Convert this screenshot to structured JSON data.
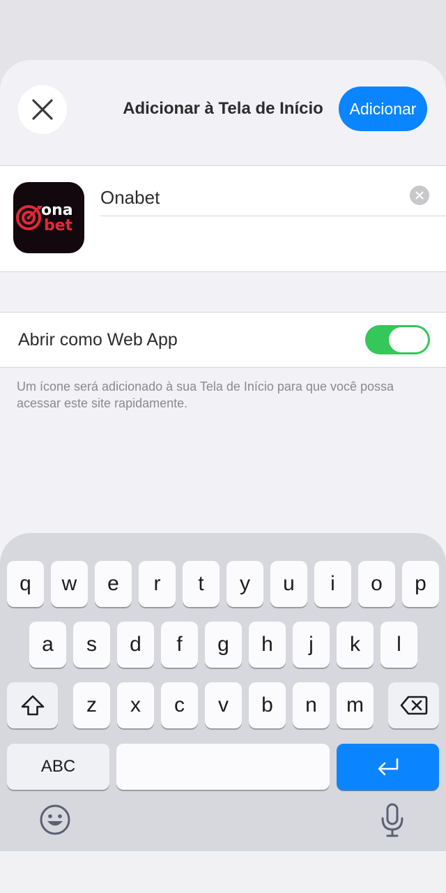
{
  "header": {
    "title": "Adicionar à Tela de Início",
    "add_label": "Adicionar",
    "close_icon": "close-icon"
  },
  "app": {
    "name": "Onabet",
    "icon_text_top": "ona",
    "icon_text_bottom": "bet"
  },
  "settings": {
    "web_app_label": "Abrir como Web App",
    "web_app_enabled": true
  },
  "footnote": "Um ícone será adicionado à sua Tela de Início para que você possa acessar este site rapidamente.",
  "keyboard": {
    "row1": [
      "q",
      "w",
      "e",
      "r",
      "t",
      "y",
      "u",
      "i",
      "o",
      "p"
    ],
    "row2": [
      "a",
      "s",
      "d",
      "f",
      "g",
      "h",
      "j",
      "k",
      "l"
    ],
    "row3": [
      "z",
      "x",
      "c",
      "v",
      "b",
      "n",
      "m"
    ],
    "abc_label": "ABC",
    "icons": [
      "shift-icon",
      "delete-icon",
      "return-icon",
      "emoji-icon",
      "microphone-icon"
    ]
  },
  "colors": {
    "accent": "#0a84ff",
    "toggle_on": "#34c759",
    "brand_red": "#e5283a"
  }
}
